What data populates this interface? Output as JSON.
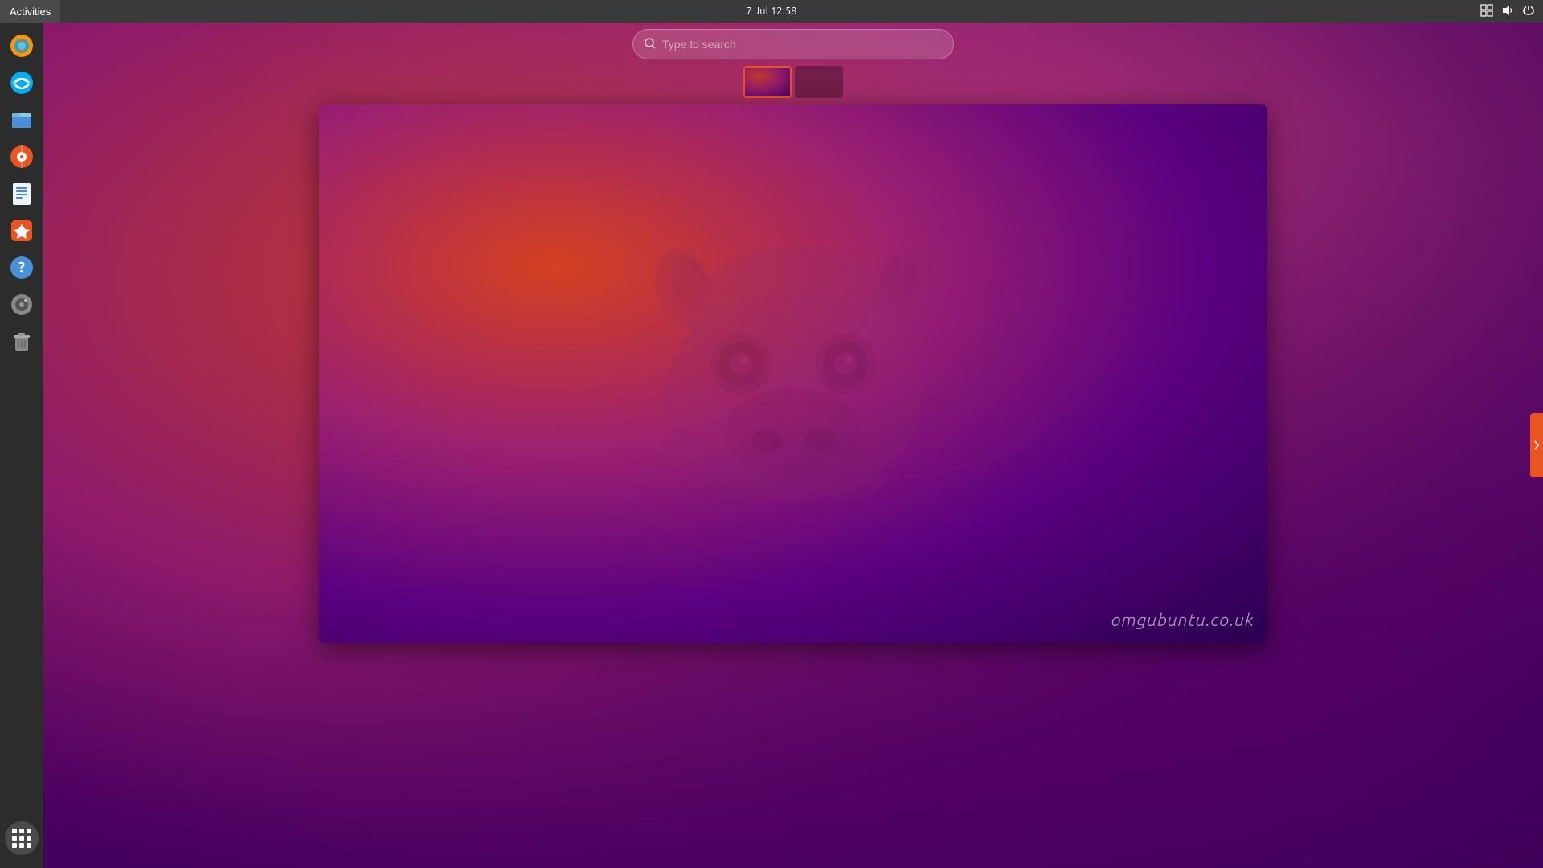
{
  "topbar": {
    "activities_label": "Activities",
    "clock": "7 Jul  12:58"
  },
  "search": {
    "placeholder": "Type to search"
  },
  "workspace": {
    "active_index": 0,
    "thumbs": [
      {
        "id": 1,
        "active": true
      },
      {
        "id": 2,
        "active": false
      }
    ]
  },
  "watermark": {
    "text": "omgubuntu.co.uk"
  },
  "sidebar": {
    "items": [
      {
        "name": "firefox",
        "label": "Firefox"
      },
      {
        "name": "thunderbird",
        "label": "Thunderbird"
      },
      {
        "name": "files",
        "label": "Files"
      },
      {
        "name": "rhythmbox",
        "label": "Rhythmbox"
      },
      {
        "name": "writer",
        "label": "LibreOffice Writer"
      },
      {
        "name": "app-center",
        "label": "App Center"
      },
      {
        "name": "help",
        "label": "Help"
      },
      {
        "name": "disk",
        "label": "Disk"
      },
      {
        "name": "trash",
        "label": "Trash"
      }
    ],
    "show_apps_label": "Show Apps"
  },
  "tray": {
    "network_icon": "⊞",
    "sound_icon": "🔊",
    "power_icon": "⏻"
  }
}
